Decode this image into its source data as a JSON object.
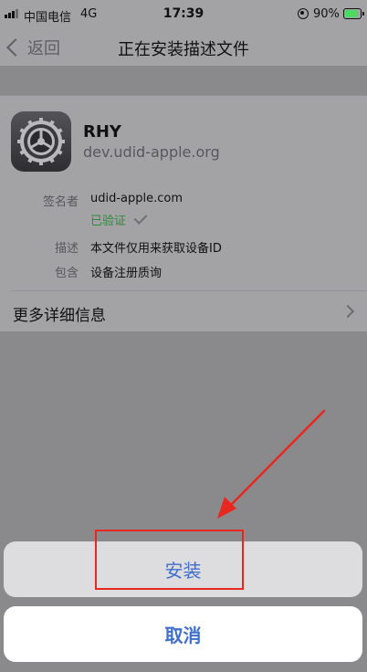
{
  "status_bar": {
    "carrier": "中国电信",
    "network": "4G",
    "time": "17:39",
    "battery_percent": "90%",
    "battery_level": 0.9,
    "battery_color": "#4cd964"
  },
  "nav": {
    "back_label": "返回",
    "title": "正在安装描述文件"
  },
  "profile": {
    "icon": "settings-gear-icon",
    "name": "RHY",
    "domain": "dev.udid-apple.org",
    "signer_label": "签名者",
    "signer_value": "udid-apple.com",
    "verified_label": "已验证",
    "description_label": "描述",
    "description_value": "本文件仅用来获取设备ID",
    "contains_label": "包含",
    "contains_value": "设备注册质询",
    "more_info_label": "更多详细信息"
  },
  "action_sheet": {
    "install_label": "安装",
    "cancel_label": "取消"
  },
  "colors": {
    "accent_blue": "#3f6ecc",
    "verified_green": "#2e8a3c",
    "annotation_red": "#e8271f"
  }
}
